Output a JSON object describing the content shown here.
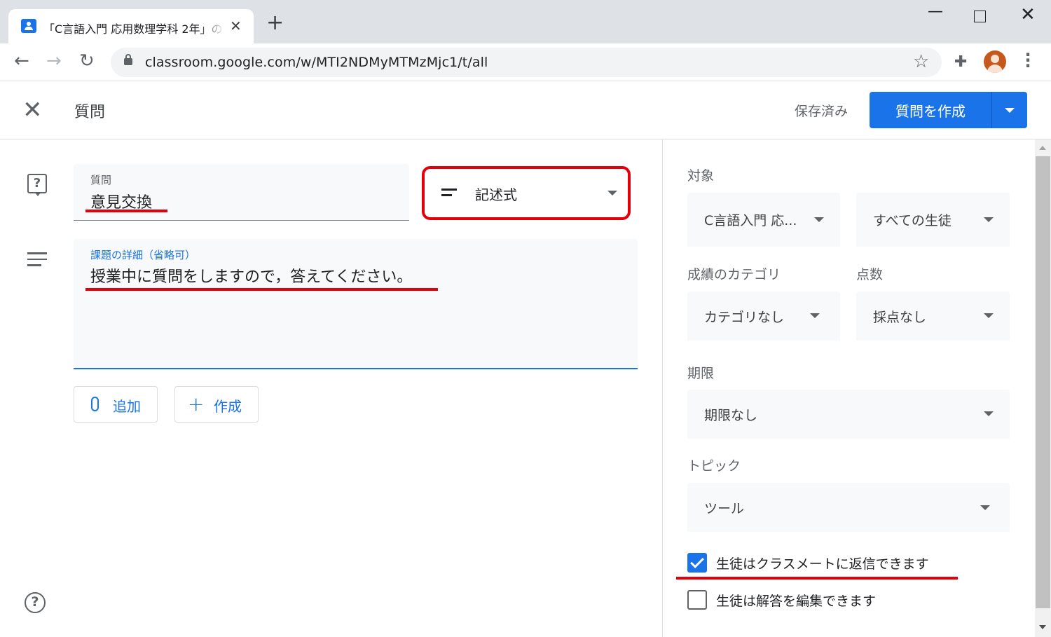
{
  "browser": {
    "tab_title": "「C言語入門 応用数理学科 2年」の",
    "tab_close": "✕",
    "new_tab": "+",
    "url": "classroom.google.com/w/MTI2NDMyMTMzMjc1/t/all",
    "window_minimize": "—",
    "window_close": "✕"
  },
  "header": {
    "title": "質問",
    "saved_status": "保存済み",
    "create_button": "質問を作成"
  },
  "question_form": {
    "title_label": "質問",
    "title_value": "意見交換",
    "question_type": "記述式",
    "details_label": "課題の詳細（省略可）",
    "details_value": "授業中に質問をしますので，答えてください。",
    "add_button": "追加",
    "create_button": "作成"
  },
  "settings": {
    "target_label": "対象",
    "class_select": "C言語入門 応...",
    "students_select": "すべての生徒",
    "grade_category_label": "成績のカテゴリ",
    "grade_category_value": "カテゴリなし",
    "points_label": "点数",
    "points_value": "採点なし",
    "due_label": "期限",
    "due_value": "期限なし",
    "topic_label": "トピック",
    "topic_value": "ツール",
    "reply_checkbox_label": "生徒はクラスメートに返信できます",
    "reply_checked": true,
    "edit_checkbox_label": "生徒は解答を編集できます",
    "edit_checked": false
  },
  "colors": {
    "accent": "#1a73e8",
    "annotation_red": "#e3000b"
  },
  "icons": [
    "classroom-favicon",
    "back-icon",
    "forward-icon",
    "reload-icon",
    "lock-icon",
    "star-icon",
    "extensions-icon",
    "profile-avatar",
    "menu-icon",
    "close-icon",
    "question-icon",
    "description-icon",
    "short-answer-icon",
    "attach-icon",
    "plus-icon",
    "help-icon"
  ]
}
